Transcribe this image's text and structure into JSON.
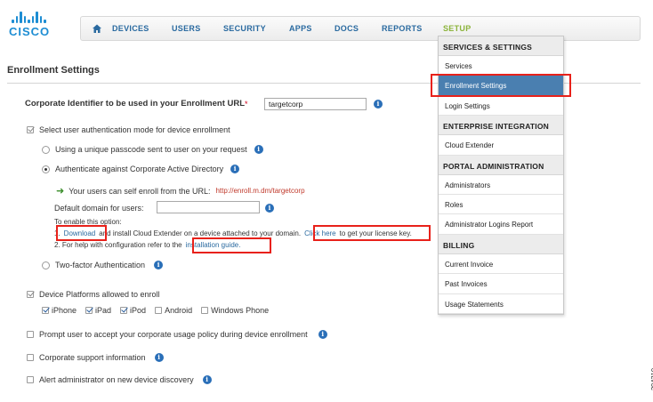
{
  "brand": {
    "logo_text": "CISCO"
  },
  "nav": {
    "items": [
      "DEVICES",
      "USERS",
      "SECURITY",
      "APPS",
      "DOCS",
      "REPORTS",
      "SETUP"
    ],
    "active": "SETUP"
  },
  "page": {
    "title": "Enrollment Settings"
  },
  "form": {
    "corp_id_label": "Corporate Identifier to be used in your Enrollment URL",
    "required_mark": "*",
    "corp_id_value": "targetcorp",
    "auth_mode_label": "Select user authentication mode for device enrollment",
    "passcode_label": "Using a unique passcode sent to user on your request",
    "ad_label": "Authenticate against Corporate Active Directory",
    "self_enroll_text": "Your users can self enroll from the URL:",
    "self_enroll_url": "http://enroll.m.dm/targetcorp",
    "default_domain_label": "Default domain for users:",
    "default_domain_value": "",
    "enable_option_text": "To enable this option:",
    "step1_prefix": "1.",
    "download_link": "Download",
    "step1_middle": "and install Cloud Extender on a device attached to your domain.",
    "click_here_link": "Click here",
    "step1_suffix": "to get your license key.",
    "step2_prefix": "2. For help with configuration refer to the",
    "install_guide_link": "installation guide.",
    "two_factor_label": "Two-factor Authentication",
    "platforms_label": "Device Platforms allowed to enroll",
    "platforms": [
      {
        "label": "iPhone",
        "checked": true
      },
      {
        "label": "iPad",
        "checked": true
      },
      {
        "label": "iPod",
        "checked": true
      },
      {
        "label": "Android",
        "checked": false
      },
      {
        "label": "Windows Phone",
        "checked": false
      }
    ],
    "usage_policy_label": "Prompt user to accept your corporate usage policy during device enrollment",
    "support_info_label": "Corporate support information",
    "alert_admin_label": "Alert administrator on new device discovery"
  },
  "setup_menu": {
    "sections": [
      {
        "heading": "SERVICES & SETTINGS",
        "items": [
          "Services",
          "Enrollment Settings",
          "Login Settings"
        ]
      },
      {
        "heading": "ENTERPRISE INTEGRATION",
        "items": [
          "Cloud Extender"
        ]
      },
      {
        "heading": "PORTAL ADMINISTRATION",
        "items": [
          "Administrators",
          "Roles",
          "Administrator Logins Report"
        ]
      },
      {
        "heading": "BILLING",
        "items": [
          "Current Invoice",
          "Past Invoices",
          "Usage Statements"
        ]
      }
    ],
    "selected_item": "Enrollment Settings"
  },
  "figure_id": "294310",
  "colors": {
    "accent": "#2a6aa0",
    "active_nav": "#8cb43b",
    "highlight": "#e8211a",
    "selected": "#4a7fb0"
  }
}
